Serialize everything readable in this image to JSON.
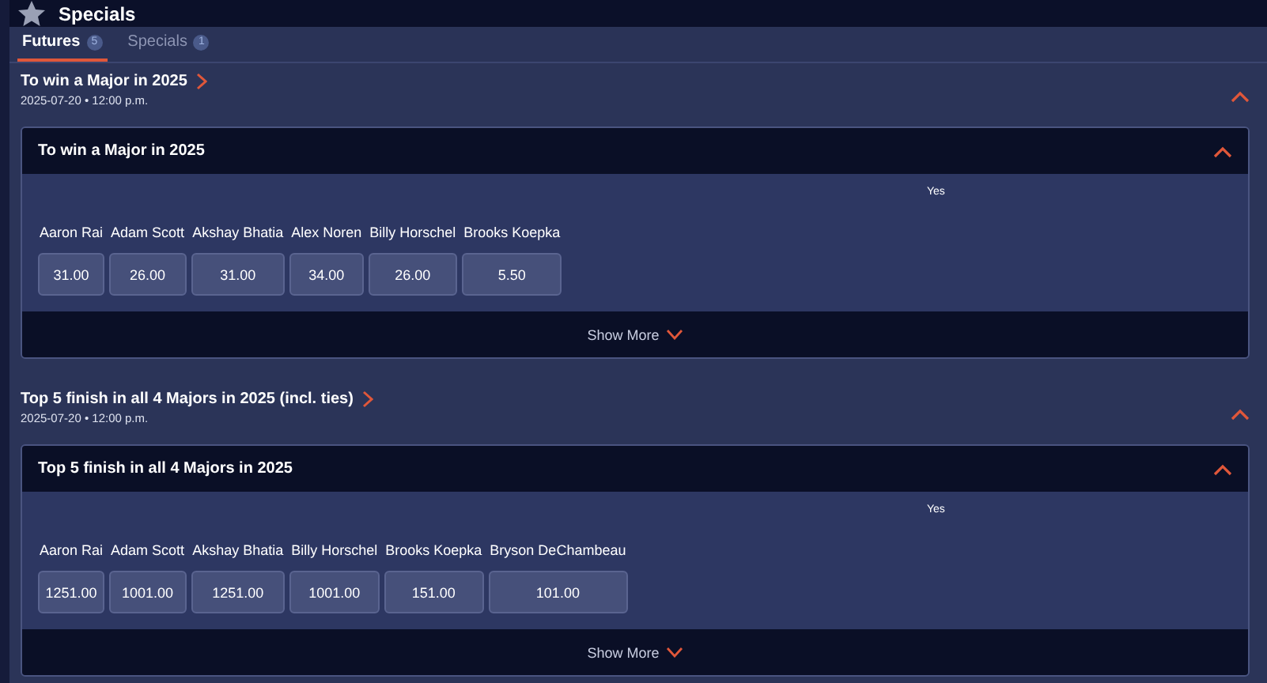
{
  "header": {
    "title": "Specials"
  },
  "tabs": [
    {
      "label": "Futures",
      "count": "5",
      "selected": true
    },
    {
      "label": "Specials",
      "count": "1",
      "selected": false
    }
  ],
  "events": [
    {
      "title": "To win a Major in 2025",
      "date": "2025-07-20 • 12:00 p.m.",
      "expanded": true,
      "market": {
        "title": "To win a Major in 2025",
        "expanded": true,
        "column_header": "Yes",
        "footer": "Show More",
        "selections": [
          {
            "name": "Aaron Rai",
            "odds": "31.00"
          },
          {
            "name": "Adam Scott",
            "odds": "26.00"
          },
          {
            "name": "Akshay Bhatia",
            "odds": "31.00"
          },
          {
            "name": "Alex Noren",
            "odds": "34.00"
          },
          {
            "name": "Billy Horschel",
            "odds": "26.00"
          },
          {
            "name": "Brooks Koepka",
            "odds": "5.50"
          }
        ]
      }
    },
    {
      "title": "Top 5 finish in all 4 Majors in 2025 (incl. ties)",
      "date": "2025-07-20 • 12:00 p.m.",
      "expanded": true,
      "market": {
        "title": "Top 5 finish in all 4 Majors in 2025",
        "expanded": true,
        "column_header": "Yes",
        "footer": "Show More",
        "selections": [
          {
            "name": "Aaron Rai",
            "odds": "1251.00"
          },
          {
            "name": "Adam Scott",
            "odds": "1001.00"
          },
          {
            "name": "Akshay Bhatia",
            "odds": "1251.00"
          },
          {
            "name": "Billy Horschel",
            "odds": "1001.00"
          },
          {
            "name": "Brooks Koepka",
            "odds": "151.00"
          },
          {
            "name": "Bryson DeChambeau",
            "odds": "101.00"
          }
        ]
      }
    }
  ]
}
